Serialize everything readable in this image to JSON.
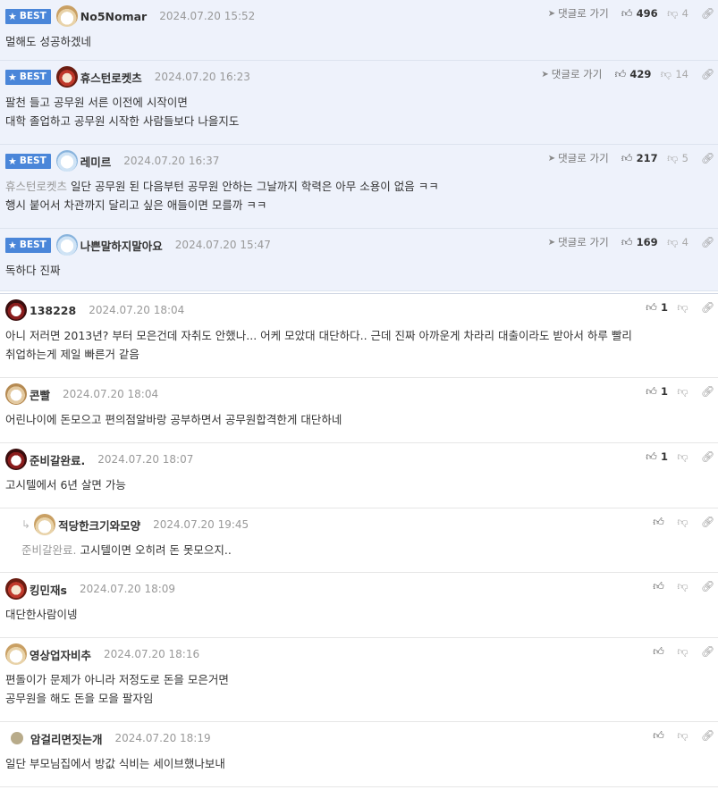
{
  "labels": {
    "best": "BEST",
    "reply_link": "댓글로 가기"
  },
  "best_comments": [
    {
      "avatar": "dog-avatar",
      "nick": "No5Nomar",
      "date": "2024.07.20 15:52",
      "up": "496",
      "down": "4",
      "lines": [
        "멀해도 성공하겠네"
      ]
    },
    {
      "avatar": "lion-avatar",
      "nick": "휴스턴로켓츠",
      "date": "2024.07.20 16:23",
      "up": "429",
      "down": "14",
      "lines": [
        "팔천 들고 공무원 서른 이전에 시작이면",
        "대학 졸업하고 공무원 시작한 사람들보다 나을지도"
      ]
    },
    {
      "avatar": "polar-avatar",
      "nick": "레미르",
      "date": "2024.07.20 16:37",
      "up": "217",
      "down": "5",
      "mention": "휴스턴로켓츠",
      "lines": [
        "일단 공무원 된 다음부턴 공무원 안하는 그날까지 학력은 아무 소용이 없음 ㅋㅋ",
        "행시 붙어서 차관까지 달리고 싶은 애들이면 모를까 ㅋㅋ"
      ]
    },
    {
      "avatar": "polar-avatar",
      "nick": "나쁜말하지말아요",
      "date": "2024.07.20 15:47",
      "up": "169",
      "down": "4",
      "lines": [
        "독하다 진짜"
      ]
    }
  ],
  "comments": [
    {
      "avatar": "pup-avatar",
      "nick": "138228",
      "date": "2024.07.20 18:04",
      "up": "1",
      "lines": [
        "아니 저러면 2013년? 부터 모은건데 자취도 안했나... 어케 모았대 대단하다.. 근데 진짜 아까운게 차라리 대출이라도 받아서 하루 빨리",
        "취업하는게 제일 빠른거 같음"
      ]
    },
    {
      "avatar": "small-avatar",
      "nick": "콘빨",
      "date": "2024.07.20 18:04",
      "up": "1",
      "lines": [
        "어린나이에 돈모으고 편의점알바랑 공부하면서 공무원합격한게 대단하네"
      ]
    },
    {
      "avatar": "pup-avatar",
      "nick": "준비갈완료.",
      "date": "2024.07.20 18:07",
      "up": "1",
      "lines": [
        "고시텔에서 6년 살면 가능"
      ]
    },
    {
      "reply": true,
      "avatar": "dog-avatar",
      "nick": "적당한크기와모양",
      "date": "2024.07.20 19:45",
      "up": "",
      "mention": "준비갈완료.",
      "lines": [
        "고시텔이면 오히려 돈 못모으지.."
      ]
    },
    {
      "avatar": "lion-avatar",
      "nick": "킹민재s",
      "date": "2024.07.20 18:09",
      "up": "",
      "lines": [
        "대단한사람이넹"
      ]
    },
    {
      "avatar": "dog-avatar",
      "nick": "영상업자비추",
      "date": "2024.07.20 18:16",
      "up": "",
      "lines": [
        "편돌이가 문제가 아니라 저정도로 돈을 모은거면",
        "공무원을 해도 돈을 모을 팔자임"
      ]
    },
    {
      "avatar": "ball-avatar",
      "nick": "암걸리면짓는개",
      "date": "2024.07.20 18:19",
      "up": "",
      "lines": [
        "일단 부모님집에서 방값 식비는 세이브했나보내"
      ]
    }
  ]
}
